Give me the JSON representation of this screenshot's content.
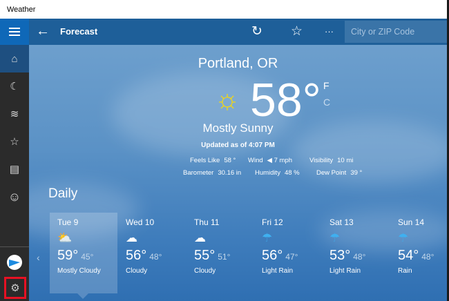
{
  "window": {
    "title": "Weather"
  },
  "header": {
    "title": "Forecast",
    "search_placeholder": "City or ZIP Code",
    "back": "←",
    "refresh": "↻",
    "favorite": "☆",
    "more": "···"
  },
  "sidebar": {
    "items": [
      "home",
      "maps",
      "historical-weather",
      "favorites",
      "news",
      "feedback"
    ],
    "glyphs": [
      "⌂",
      "☾",
      "≋",
      "☆",
      "▤",
      "☺"
    ],
    "settings": "⚙"
  },
  "current": {
    "location": "Portland, OR",
    "temperature": "58°",
    "unit_f": "F",
    "unit_c": "C",
    "condition": "Mostly Sunny",
    "updated": "Updated as of 4:07 PM",
    "sun_icon": "☼",
    "details": [
      {
        "label": "Feels Like",
        "value": "58 °"
      },
      {
        "label": "Wind",
        "value": "◀ 7 mph"
      },
      {
        "label": "Visibility",
        "value": "10 mi"
      },
      {
        "label": "Barometer",
        "value": "30.16 in"
      },
      {
        "label": "Humidity",
        "value": "48 %"
      },
      {
        "label": "Dew Point",
        "value": "39 °"
      }
    ]
  },
  "daily": {
    "title": "Daily",
    "prev": "‹",
    "days": [
      {
        "day": "Tue 9",
        "icon": "⛅",
        "high": "59°",
        "low": "45°",
        "cond": "Mostly Cloudy"
      },
      {
        "day": "Wed 10",
        "icon": "☁",
        "high": "56°",
        "low": "48°",
        "cond": "Cloudy"
      },
      {
        "day": "Thu 11",
        "icon": "☁",
        "high": "55°",
        "low": "51°",
        "cond": "Cloudy"
      },
      {
        "day": "Fri 12",
        "icon": "☂",
        "high": "56°",
        "low": "47°",
        "cond": "Light Rain"
      },
      {
        "day": "Sat 13",
        "icon": "☂",
        "high": "53°",
        "low": "48°",
        "cond": "Light Rain"
      },
      {
        "day": "Sun 14",
        "icon": "☂",
        "high": "54°",
        "low": "48°",
        "cond": "Rain"
      }
    ]
  }
}
